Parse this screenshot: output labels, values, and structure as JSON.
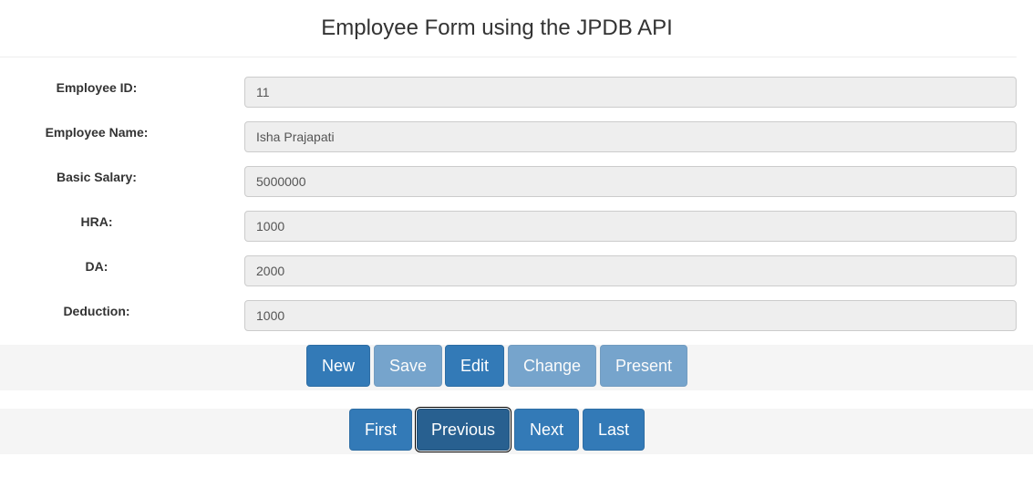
{
  "header": {
    "title": "Employee Form using the JPDB API"
  },
  "form": {
    "fields": [
      {
        "label": "Employee ID:",
        "value": "11"
      },
      {
        "label": "Employee Name:",
        "value": "Isha Prajapati"
      },
      {
        "label": "Basic Salary:",
        "value": "5000000"
      },
      {
        "label": "HRA:",
        "value": "1000"
      },
      {
        "label": "DA:",
        "value": "2000"
      },
      {
        "label": "Deduction:",
        "value": "1000"
      }
    ]
  },
  "actions": {
    "new_label": "New",
    "save_label": "Save",
    "edit_label": "Edit",
    "change_label": "Change",
    "present_label": "Present"
  },
  "navigation": {
    "first_label": "First",
    "previous_label": "Previous",
    "next_label": "Next",
    "last_label": "Last"
  },
  "colors": {
    "primary": "#337ab7",
    "primary_active": "#286090",
    "field_background": "#eeeeee",
    "bar_background": "#f5f5f5"
  }
}
